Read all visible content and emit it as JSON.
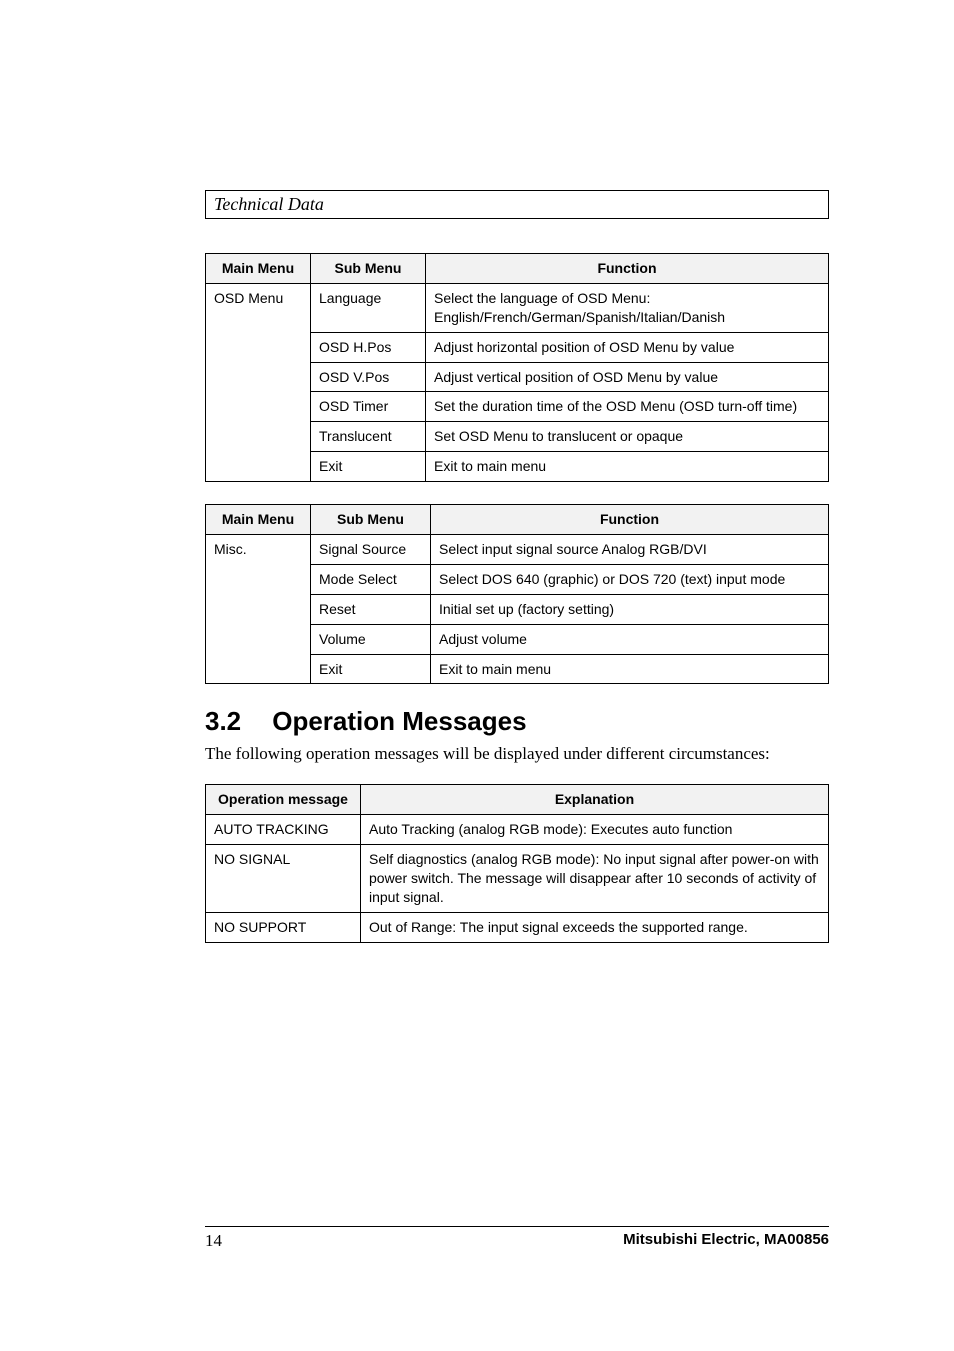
{
  "section_header": "Technical Data",
  "table1": {
    "headers": [
      "Main Menu",
      "Sub Menu",
      "Function"
    ],
    "group": "OSD Menu",
    "rows": [
      {
        "sub": "Language",
        "fn": "Select the language of OSD Menu:\nEnglish/French/German/Spanish/Italian/Danish"
      },
      {
        "sub": "OSD H.Pos",
        "fn": "Adjust horizontal position of OSD Menu by value"
      },
      {
        "sub": "OSD V.Pos",
        "fn": "Adjust vertical position of OSD Menu by value"
      },
      {
        "sub": "OSD Timer",
        "fn": "Set the duration time of the OSD Menu (OSD turn-off time)"
      },
      {
        "sub": "Translucent",
        "fn": "Set OSD Menu to translucent or opaque"
      },
      {
        "sub": "Exit",
        "fn": "Exit to main menu"
      }
    ]
  },
  "table2": {
    "headers": [
      "Main Menu",
      "Sub Menu",
      "Function"
    ],
    "group": "Misc.",
    "rows": [
      {
        "sub": "Signal Source",
        "fn": "Select input signal source\nAnalog RGB/DVI"
      },
      {
        "sub": "Mode Select",
        "fn": "Select DOS 640 (graphic) or DOS 720 (text) input mode"
      },
      {
        "sub": "Reset",
        "fn": "Initial set up (factory setting)"
      },
      {
        "sub": "Volume",
        "fn": "Adjust volume"
      },
      {
        "sub": "Exit",
        "fn": "Exit to main menu"
      }
    ]
  },
  "heading": {
    "num": "3.2",
    "title": "Operation Messages"
  },
  "intro": "The following operation messages will be displayed under different circumstances:",
  "table3": {
    "headers": [
      "Operation message",
      "Explanation"
    ],
    "rows": [
      {
        "op": "AUTO TRACKING",
        "exp": "Auto Tracking (analog RGB mode):\nExecutes auto function"
      },
      {
        "op": "NO SIGNAL",
        "exp": "Self diagnostics (analog RGB mode):\nNo input signal after power-on with power switch.\nThe message will disappear after 10 seconds of activity of input signal."
      },
      {
        "op": "NO SUPPORT",
        "exp": "Out of Range:\nThe input signal exceeds the supported range."
      }
    ]
  },
  "footer": {
    "page": "14",
    "doc": "Mitsubishi Electric, MA00856"
  }
}
